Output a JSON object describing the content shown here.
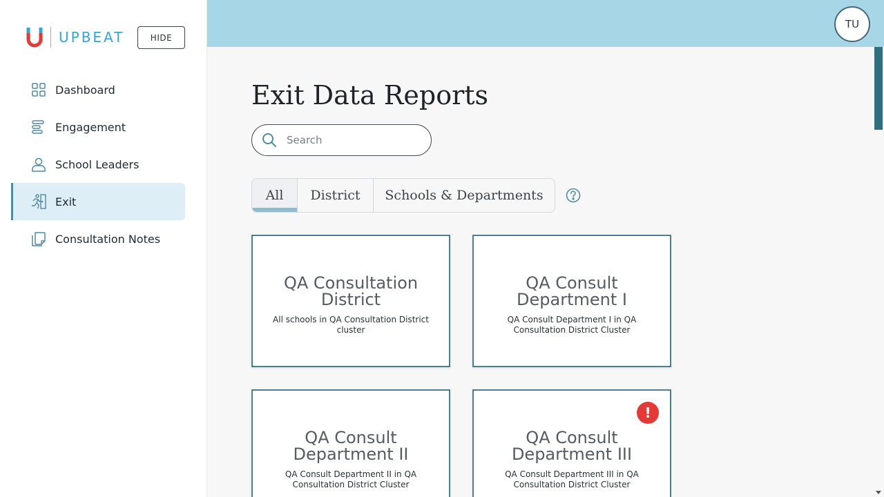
{
  "brand": {
    "name": "UPBEAT",
    "hide_label": "HIDE"
  },
  "nav": {
    "items": [
      {
        "label": "Dashboard",
        "icon": "grid-icon"
      },
      {
        "label": "Engagement",
        "icon": "bars-icon"
      },
      {
        "label": "School Leaders",
        "icon": "person-icon"
      },
      {
        "label": "Exit",
        "icon": "running-exit-icon",
        "active": true
      },
      {
        "label": "Consultation Notes",
        "icon": "notes-icon"
      }
    ]
  },
  "header": {
    "avatar_initials": "TU"
  },
  "main": {
    "title": "Exit Data Reports",
    "search": {
      "placeholder": "Search",
      "value": ""
    },
    "tabs": [
      {
        "label": "All",
        "active": true
      },
      {
        "label": "District"
      },
      {
        "label": "Schools & Departments"
      }
    ],
    "cards": [
      {
        "title": "QA Consultation District",
        "subtitle": "All schools in QA Consultation District cluster",
        "alert": false
      },
      {
        "title": "QA Consult Department I",
        "subtitle": "QA Consult Department I in QA Consultation District Cluster",
        "alert": false
      },
      {
        "title": "QA Consult Department II",
        "subtitle": "QA Consult Department II in QA Consultation District Cluster",
        "alert": false
      },
      {
        "title": "QA Consult Department III",
        "subtitle": "QA Consult Department III in QA Consultation District Cluster",
        "alert": true,
        "alert_symbol": "!"
      }
    ]
  },
  "colors": {
    "accent": "#4f8aa3",
    "topbar": "#a7d6e6",
    "card_border": "#4a7f8f",
    "alert": "#e53935",
    "brand": "#2fa8d9"
  }
}
